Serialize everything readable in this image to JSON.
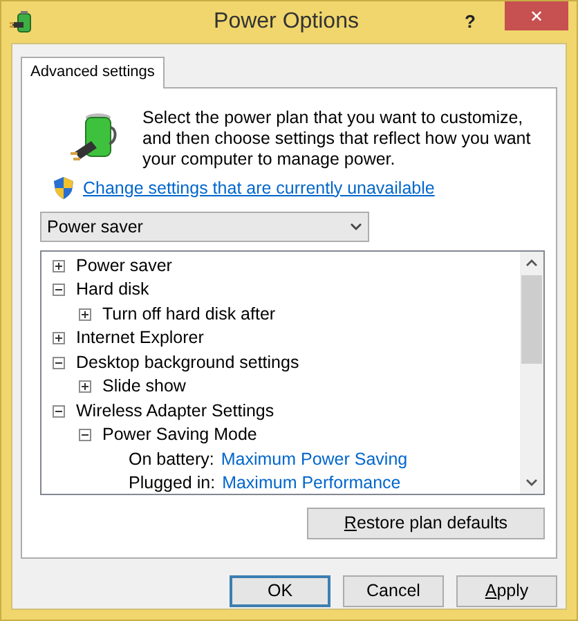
{
  "window": {
    "title": "Power Options",
    "help": "?",
    "close": "✕"
  },
  "tabs": [
    {
      "label": "Advanced settings",
      "selected": true
    }
  ],
  "description": "Select the power plan that you want to customize, and then choose settings that reflect how you want your computer to manage power.",
  "link": "Change settings that are currently unavailable",
  "plan_select": {
    "value": "Power saver"
  },
  "tree": [
    {
      "label": "Power saver",
      "expanded": false
    },
    {
      "label": "Hard disk",
      "expanded": true,
      "children": [
        {
          "label": "Turn off hard disk after",
          "expanded": false
        }
      ]
    },
    {
      "label": "Internet Explorer",
      "expanded": false
    },
    {
      "label": "Desktop background settings",
      "expanded": true,
      "children": [
        {
          "label": "Slide show",
          "expanded": false
        }
      ]
    },
    {
      "label": "Wireless Adapter Settings",
      "expanded": true,
      "children": [
        {
          "label": "Power Saving Mode",
          "expanded": true,
          "settings": [
            {
              "label": "On battery:",
              "value": "Maximum Power Saving"
            },
            {
              "label": "Plugged in:",
              "value": "Maximum Performance"
            }
          ]
        }
      ]
    }
  ],
  "restore_button": {
    "label": "Restore plan defaults",
    "underline_first": true
  },
  "buttons": [
    {
      "label": "OK",
      "default": true,
      "underline_first": false
    },
    {
      "label": "Cancel",
      "default": false,
      "underline_first": false
    },
    {
      "label": "Apply",
      "default": false,
      "underline_first": true
    }
  ]
}
